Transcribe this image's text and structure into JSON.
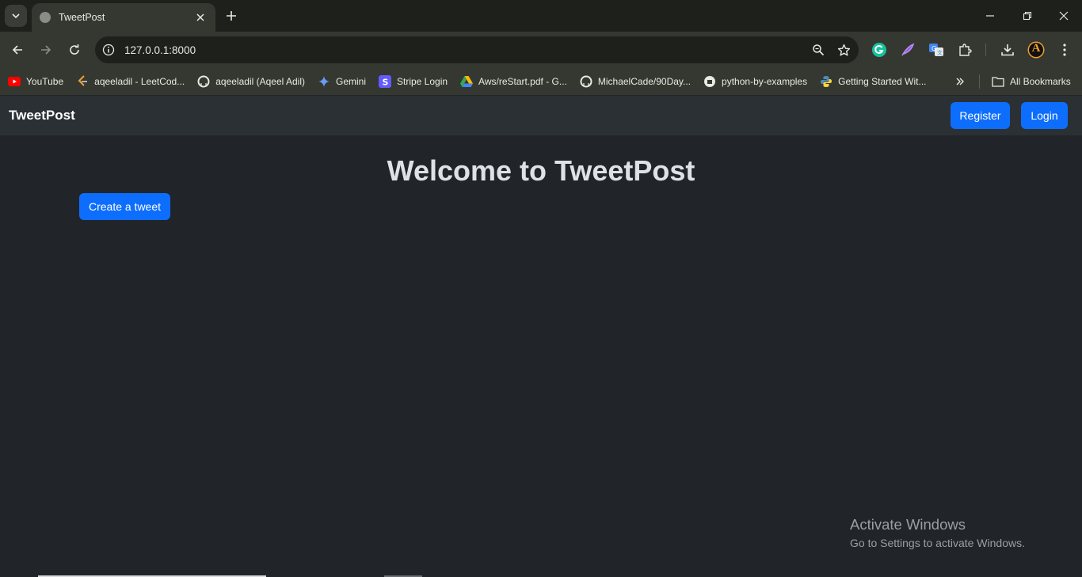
{
  "browser": {
    "tab_title": "TweetPost",
    "url": "127.0.0.1:8000",
    "bookmarks": [
      {
        "label": "YouTube",
        "icon": "youtube-icon"
      },
      {
        "label": "aqeeladil - LeetCod...",
        "icon": "leetcode-icon"
      },
      {
        "label": "aqeeladil (Aqeel Adil)",
        "icon": "github-icon"
      },
      {
        "label": "Gemini",
        "icon": "gemini-icon"
      },
      {
        "label": "Stripe Login",
        "icon": "stripe-icon"
      },
      {
        "label": "Aws/reStart.pdf - G...",
        "icon": "google-drive-icon"
      },
      {
        "label": "MichaelCade/90Day...",
        "icon": "github-icon"
      },
      {
        "label": "python-by-examples",
        "icon": "python-examples-icon"
      },
      {
        "label": "Getting Started Wit...",
        "icon": "python-icon"
      }
    ],
    "all_bookmarks": "All Bookmarks",
    "profile_initial": "A"
  },
  "page": {
    "brand": "TweetPost",
    "register_label": "Register",
    "login_label": "Login",
    "title": "Welcome to TweetPost",
    "create_label": "Create a tweet"
  },
  "windows_watermark": {
    "title": "Activate Windows",
    "subtitle": "Go to Settings to activate Windows."
  },
  "colors": {
    "primary": "#0d6efd",
    "page_bg": "#212529",
    "navbar_bg": "#2b3035",
    "chrome_bg": "#353831"
  }
}
